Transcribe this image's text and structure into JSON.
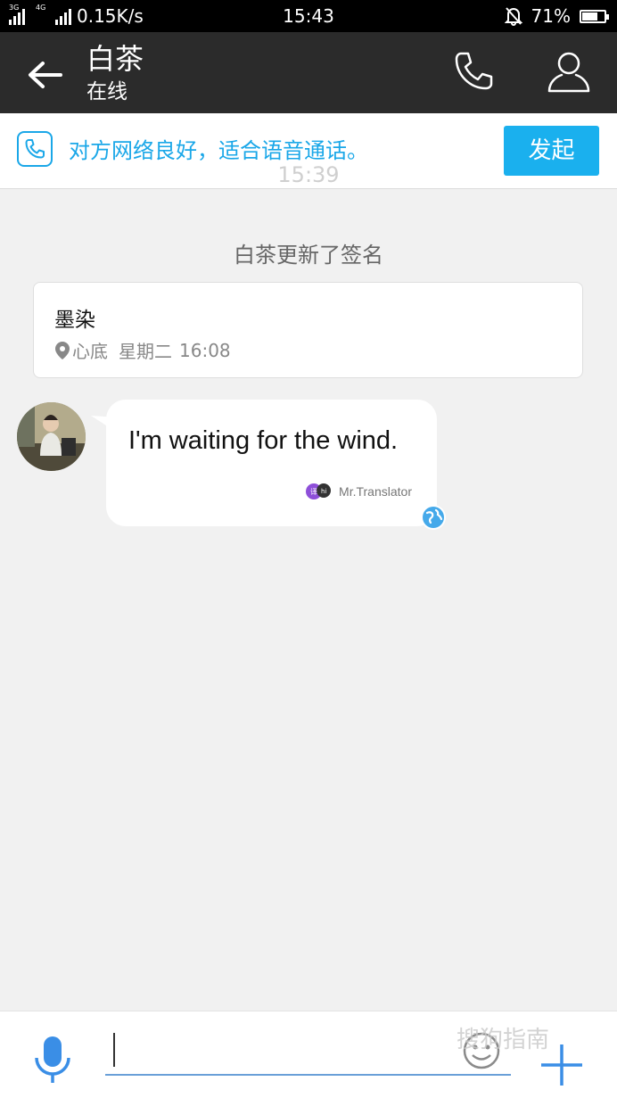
{
  "status_bar": {
    "network_left": "3G",
    "network_right": "4G",
    "speed": "0.15K/s",
    "time": "15:43",
    "battery": "71%",
    "battery_level": 0.71
  },
  "header": {
    "title": "白茶",
    "subtitle": "在线"
  },
  "call_notice": {
    "text": "对方网络良好，适合语音通话。",
    "button": "发起"
  },
  "chat": {
    "ghost_time": "15:39",
    "system_message": "白茶更新了签名",
    "signature_card": {
      "name": "墨染",
      "location": "心底",
      "day": "星期二",
      "time": "16:08"
    },
    "message": {
      "text": "I'm waiting for the wind.",
      "translator": "Mr.Translator"
    }
  },
  "input_bar": {
    "value": "",
    "watermark": "搜狗指南"
  },
  "colors": {
    "accent": "#1aa7e8",
    "header_bg": "#2b2b2b",
    "chat_bg": "#f1f1f1"
  }
}
